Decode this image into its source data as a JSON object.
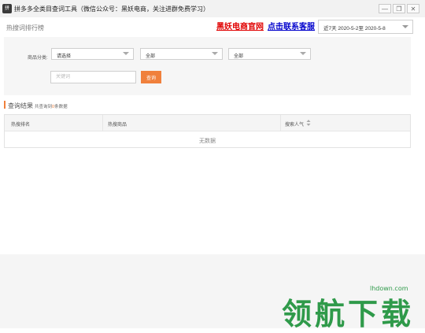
{
  "window": {
    "icon_text": "拼",
    "title": "拼多多全类目查词工具（微信公众号：黑妖电商，关注进群免费学习）",
    "minimize": "—",
    "restore": "❐",
    "close": "✕"
  },
  "header": {
    "section_title": "热搜词排行榜",
    "link_official": "黑妖电商官网",
    "link_support": "点击联系客服",
    "date_range": "近7天 2020-5-2至 2020-5-8"
  },
  "filters": {
    "category_label": "商品分类:",
    "select1": "请选择",
    "select2": "全部",
    "select3": "全部",
    "keyword_placeholder": "关键词",
    "search_button": "查询"
  },
  "results": {
    "title": "查询结果",
    "count_prefix": "共查询到",
    "count_value": "0",
    "count_suffix": "条数据",
    "columns": [
      "热搜排名",
      "热搜商品",
      "搜索人气"
    ],
    "empty_text": "无数据"
  },
  "watermark": {
    "url": "lhdown.com",
    "text": "领航下载"
  }
}
